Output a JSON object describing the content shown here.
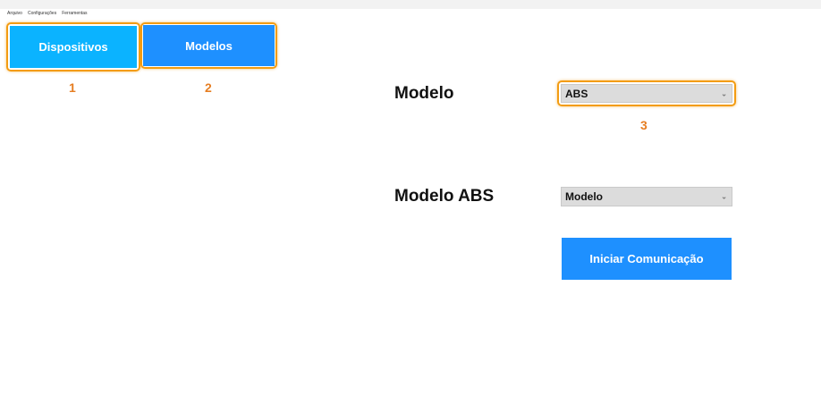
{
  "menubar": {
    "items": [
      "Arquivo",
      "Configurações",
      "Ferramentas"
    ]
  },
  "nav": {
    "dispositivos_label": "Dispositivos",
    "modelos_label": "Modelos"
  },
  "callouts": {
    "one": "1",
    "two": "2",
    "three": "3"
  },
  "form": {
    "modelo_label": "Modelo",
    "modelo_value": "ABS",
    "modelo_abs_label": "Modelo ABS",
    "modelo_abs_value": "Modelo",
    "start_button": "Iniciar Comunicação"
  },
  "colors": {
    "dispositivos_bg": "#0bb3ff",
    "modelos_bg": "#1e90ff",
    "accent_highlight": "#f39c12",
    "select_bg": "#dcdcdc"
  },
  "icons": {
    "dropdown": "chevron-down-icon"
  }
}
